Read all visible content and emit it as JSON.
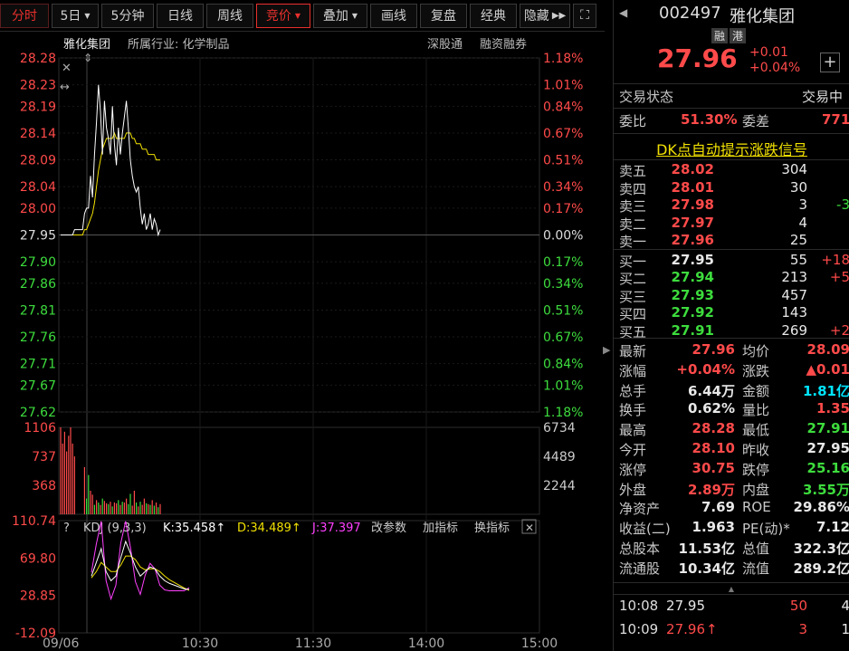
{
  "toolbar": {
    "items": [
      {
        "label": "分时",
        "state": "active"
      },
      {
        "label": "5日",
        "dropdown": true
      },
      {
        "label": "5分钟"
      },
      {
        "label": "日线"
      },
      {
        "label": "周线"
      },
      {
        "label": "竞价",
        "dropdown": true,
        "state": "accent"
      },
      {
        "label": "叠加",
        "dropdown": true
      },
      {
        "label": "画线"
      },
      {
        "label": "复盘"
      },
      {
        "label": "经典"
      },
      {
        "label": "隐藏",
        "more": true
      }
    ],
    "fullscreen_icon": "expand-icon"
  },
  "chart_header": {
    "name": "雅化集团",
    "industry": "所属行业: 化学制品",
    "links": [
      "深股通",
      "融资融券"
    ]
  },
  "price_chart": {
    "left_ticks": [
      "28.28",
      "28.23",
      "28.19",
      "28.14",
      "28.09",
      "28.04",
      "28.00",
      "27.95",
      "27.90",
      "27.86",
      "27.81",
      "27.76",
      "27.71",
      "27.67",
      "27.62"
    ],
    "right_ticks": [
      "1.18%",
      "1.01%",
      "0.84%",
      "0.67%",
      "0.51%",
      "0.34%",
      "0.17%",
      "0.00%",
      "0.17%",
      "0.34%",
      "0.51%",
      "0.67%",
      "0.84%",
      "1.01%",
      "1.18%"
    ]
  },
  "volume_chart": {
    "left_ticks": [
      "1106",
      "737",
      "368"
    ],
    "right_ticks": [
      "6734",
      "4489",
      "2244"
    ]
  },
  "kdj": {
    "title": "KDJ (9,3,3)",
    "k": "K:35.458↑",
    "d": "D:34.489↑",
    "j": "J:37.397",
    "buttons": [
      "改参数",
      "加指标",
      "换指标"
    ],
    "ticks": [
      "110.74",
      "69.80",
      "28.85",
      "-12.09"
    ]
  },
  "time_axis": [
    "09/06",
    "10:30",
    "11:30",
    "14:00",
    "15:00"
  ],
  "chart_data": {
    "type": "line",
    "x_label_ticks": [
      "09/06",
      "10:30",
      "11:30",
      "14:00",
      "15:00"
    ],
    "price": {
      "prev_close": 27.95,
      "ylim": [
        27.62,
        28.28
      ],
      "series": [
        {
          "name": "",
          "values": [
            27.95,
            27.95,
            27.95,
            27.95,
            27.95,
            27.95,
            27.95,
            27.96,
            27.96,
            27.96,
            27.96,
            27.96,
            27.99,
            28.0,
            28.0,
            28.06,
            28.02,
            28.1,
            28.16,
            28.23,
            28.18,
            28.1,
            28.2,
            28.15,
            28.13,
            28.1,
            28.19,
            28.12,
            28.08,
            28.15,
            28.1,
            28.14,
            28.17,
            28.2,
            28.15,
            28.09,
            28.06,
            28.04,
            28.03,
            28.04,
            28.0,
            27.97,
            27.99,
            27.96,
            27.97,
            27.99,
            27.96,
            27.98,
            27.97,
            27.95,
            27.96
          ]
        },
        {
          "name": "",
          "values": [
            27.95,
            27.95,
            27.95,
            27.95,
            27.95,
            27.95,
            27.95,
            27.95,
            27.95,
            27.95,
            27.95,
            27.95,
            27.96,
            27.96,
            27.97,
            27.98,
            27.99,
            28.01,
            28.04,
            28.07,
            28.09,
            28.11,
            28.12,
            28.13,
            28.13,
            28.13,
            28.13,
            28.14,
            28.13,
            28.13,
            28.13,
            28.13,
            28.13,
            28.14,
            28.14,
            28.14,
            28.13,
            28.13,
            28.12,
            28.12,
            28.12,
            28.11,
            28.11,
            28.11,
            28.1,
            28.1,
            28.1,
            28.1,
            28.09,
            28.09,
            28.09
          ]
        }
      ]
    },
    "volume": {
      "ylim": [
        0,
        1106
      ],
      "values": [
        1106,
        900,
        1050,
        800,
        1000,
        1106,
        900,
        737,
        0,
        0,
        0,
        0,
        600,
        200,
        500,
        300,
        250,
        120,
        180,
        150,
        120,
        200,
        170,
        140,
        130,
        160,
        100,
        150,
        140,
        180,
        120,
        160,
        150,
        200,
        130,
        260,
        110,
        300,
        150,
        100,
        160,
        120,
        200,
        140,
        130,
        120,
        180,
        110,
        150,
        90,
        130
      ],
      "colors": [
        "red",
        "red",
        "red",
        "red",
        "red",
        "red",
        "red",
        "red",
        "none",
        "none",
        "none",
        "none",
        "red",
        "green",
        "green",
        "red",
        "red",
        "green",
        "red",
        "green",
        "red",
        "green",
        "red",
        "red",
        "green",
        "red",
        "green",
        "red",
        "red",
        "green",
        "red",
        "green",
        "red",
        "red",
        "green",
        "green",
        "red",
        "red",
        "green",
        "red",
        "green",
        "red",
        "red",
        "green",
        "red",
        "green",
        "red",
        "green",
        "red",
        "green",
        "red"
      ]
    },
    "kdj": {
      "ylim": [
        -12.09,
        110.74
      ],
      "K": [
        50,
        65,
        80,
        55,
        45,
        50,
        70,
        88,
        75,
        60,
        50,
        55,
        60,
        58,
        50,
        45,
        42,
        40,
        38,
        36,
        35.458
      ],
      "D": [
        48,
        55,
        65,
        60,
        55,
        55,
        62,
        72,
        72,
        68,
        60,
        57,
        58,
        58,
        55,
        50,
        46,
        43,
        40,
        37,
        34.489
      ],
      "J": [
        54,
        85,
        110,
        45,
        25,
        40,
        86,
        110,
        81,
        44,
        30,
        51,
        64,
        58,
        40,
        35,
        34,
        34,
        34,
        34,
        37.397
      ]
    }
  },
  "quote": {
    "code": "002497",
    "name": "雅化集团",
    "tags": [
      "融",
      "港"
    ],
    "price": "27.96",
    "change": "+0.01",
    "change_pct": "+0.04%",
    "add_icon": "plus-icon",
    "status_label": "交易状态",
    "status_value": "交易中",
    "weibi_label": "委比",
    "weibi_value": "51.30%",
    "weicha_label": "委差",
    "weicha_value": "771",
    "dk_link": "DK点自动提示涨跌信号"
  },
  "order_book": {
    "asks": [
      {
        "label": "卖五",
        "price": "28.02",
        "vol": "304",
        "chg": ""
      },
      {
        "label": "卖四",
        "price": "28.01",
        "vol": "30",
        "chg": ""
      },
      {
        "label": "卖三",
        "price": "27.98",
        "vol": "3",
        "chg": "-3"
      },
      {
        "label": "卖二",
        "price": "27.97",
        "vol": "4",
        "chg": ""
      },
      {
        "label": "卖一",
        "price": "27.96",
        "vol": "25",
        "chg": ""
      }
    ],
    "bids": [
      {
        "label": "买一",
        "price": "27.95",
        "vol": "55",
        "chg": "+18"
      },
      {
        "label": "买二",
        "price": "27.94",
        "vol": "213",
        "chg": "+5"
      },
      {
        "label": "买三",
        "price": "27.93",
        "vol": "457",
        "chg": ""
      },
      {
        "label": "买四",
        "price": "27.92",
        "vol": "143",
        "chg": ""
      },
      {
        "label": "买五",
        "price": "27.91",
        "vol": "269",
        "chg": "+2"
      }
    ]
  },
  "stats": [
    {
      "l1": "最新",
      "v1": "27.96",
      "c1": "red",
      "l2": "均价",
      "v2": "28.09",
      "c2": "red"
    },
    {
      "l1": "涨幅",
      "v1": "+0.04%",
      "c1": "red",
      "l2": "涨跌",
      "v2": "▲0.01",
      "c2": "red"
    },
    {
      "l1": "总手",
      "v1": "6.44万",
      "c1": "white",
      "l2": "金额",
      "v2": "1.81亿",
      "c2": "cyan"
    },
    {
      "l1": "换手",
      "v1": "0.62%",
      "c1": "white",
      "l2": "量比",
      "v2": "1.35",
      "c2": "red"
    },
    {
      "l1": "最高",
      "v1": "28.28",
      "c1": "red",
      "l2": "最低",
      "v2": "27.91",
      "c2": "green"
    },
    {
      "l1": "今开",
      "v1": "28.10",
      "c1": "red",
      "l2": "昨收",
      "v2": "27.95",
      "c2": "white"
    },
    {
      "l1": "涨停",
      "v1": "30.75",
      "c1": "red",
      "l2": "跌停",
      "v2": "25.16",
      "c2": "green"
    },
    {
      "l1": "外盘",
      "v1": "2.89万",
      "c1": "red",
      "l2": "内盘",
      "v2": "3.55万",
      "c2": "green"
    },
    {
      "l1": "净资产",
      "v1": "7.69",
      "c1": "white",
      "l2": "ROE",
      "v2": "29.86%",
      "c2": "white"
    },
    {
      "l1": "收益(二)",
      "v1": "1.963",
      "c1": "white",
      "l2": "PE(动)*",
      "v2": "7.12",
      "c2": "white"
    },
    {
      "l1": "总股本",
      "v1": "11.53亿",
      "c1": "white",
      "l2": "总值",
      "v2": "322.3亿",
      "c2": "white"
    },
    {
      "l1": "流通股",
      "v1": "10.34亿",
      "c1": "white",
      "l2": "流值",
      "v2": "289.2亿",
      "c2": "white"
    }
  ],
  "trades": [
    {
      "time": "10:08",
      "price": "27.95",
      "pcolor": "white",
      "arrow": "",
      "vol": "50",
      "vcolor": "red",
      "n": "4"
    },
    {
      "time": "10:09",
      "price": "27.96",
      "pcolor": "red",
      "arrow": "↑",
      "vol": "3",
      "vcolor": "red",
      "n": "1"
    }
  ],
  "colors": {
    "up": "#ff4a4a",
    "down": "#3ddc3d",
    "grid": "#1f1f1f",
    "axis": "#3a1010",
    "yellow": "#f0e000",
    "magenta": "#ff40ff"
  }
}
